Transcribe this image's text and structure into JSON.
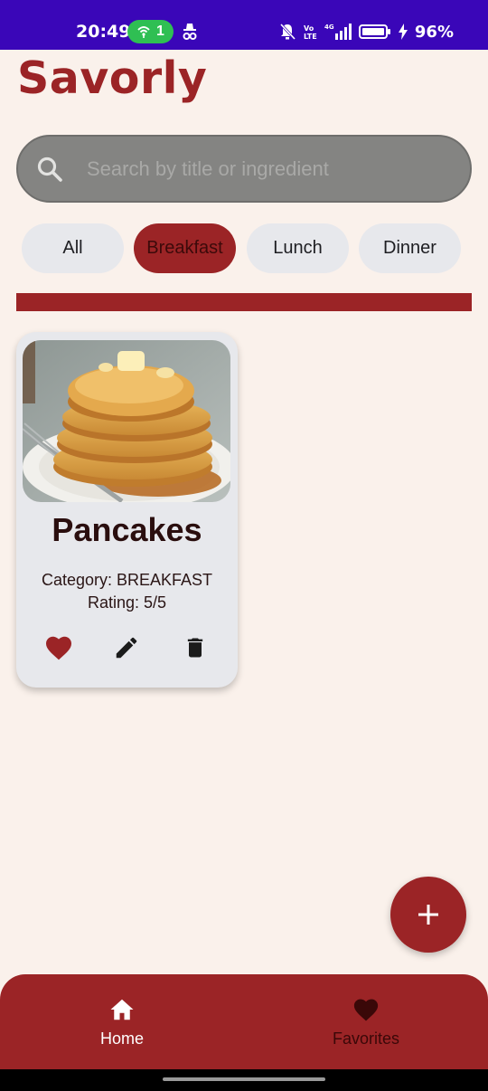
{
  "status_bar": {
    "time": "20:49",
    "hotspot_count": "1",
    "battery_percent": "96%"
  },
  "app": {
    "title": "Savorly"
  },
  "search": {
    "placeholder": "Search by title or ingredient",
    "value": ""
  },
  "filters": [
    {
      "label": "All",
      "selected": false
    },
    {
      "label": "Breakfast",
      "selected": true
    },
    {
      "label": "Lunch",
      "selected": false
    },
    {
      "label": "Dinner",
      "selected": false
    }
  ],
  "recipes": [
    {
      "title": "Pancakes",
      "category_text": "Category: BREAKFAST",
      "rating_text": "Rating: 5/5",
      "image": "pancake-stack-photo",
      "favorite": true
    }
  ],
  "fab": {
    "icon": "plus-icon"
  },
  "bottom_nav": [
    {
      "label": "Home",
      "icon": "home-icon",
      "active": true
    },
    {
      "label": "Favorites",
      "icon": "heart-icon",
      "active": false
    }
  ],
  "colors": {
    "primary": "#9B2426",
    "background": "#FAF1EB",
    "status_bar": "#3A06B8",
    "chip": "#E7E8EC",
    "search_bg": "#848482"
  }
}
